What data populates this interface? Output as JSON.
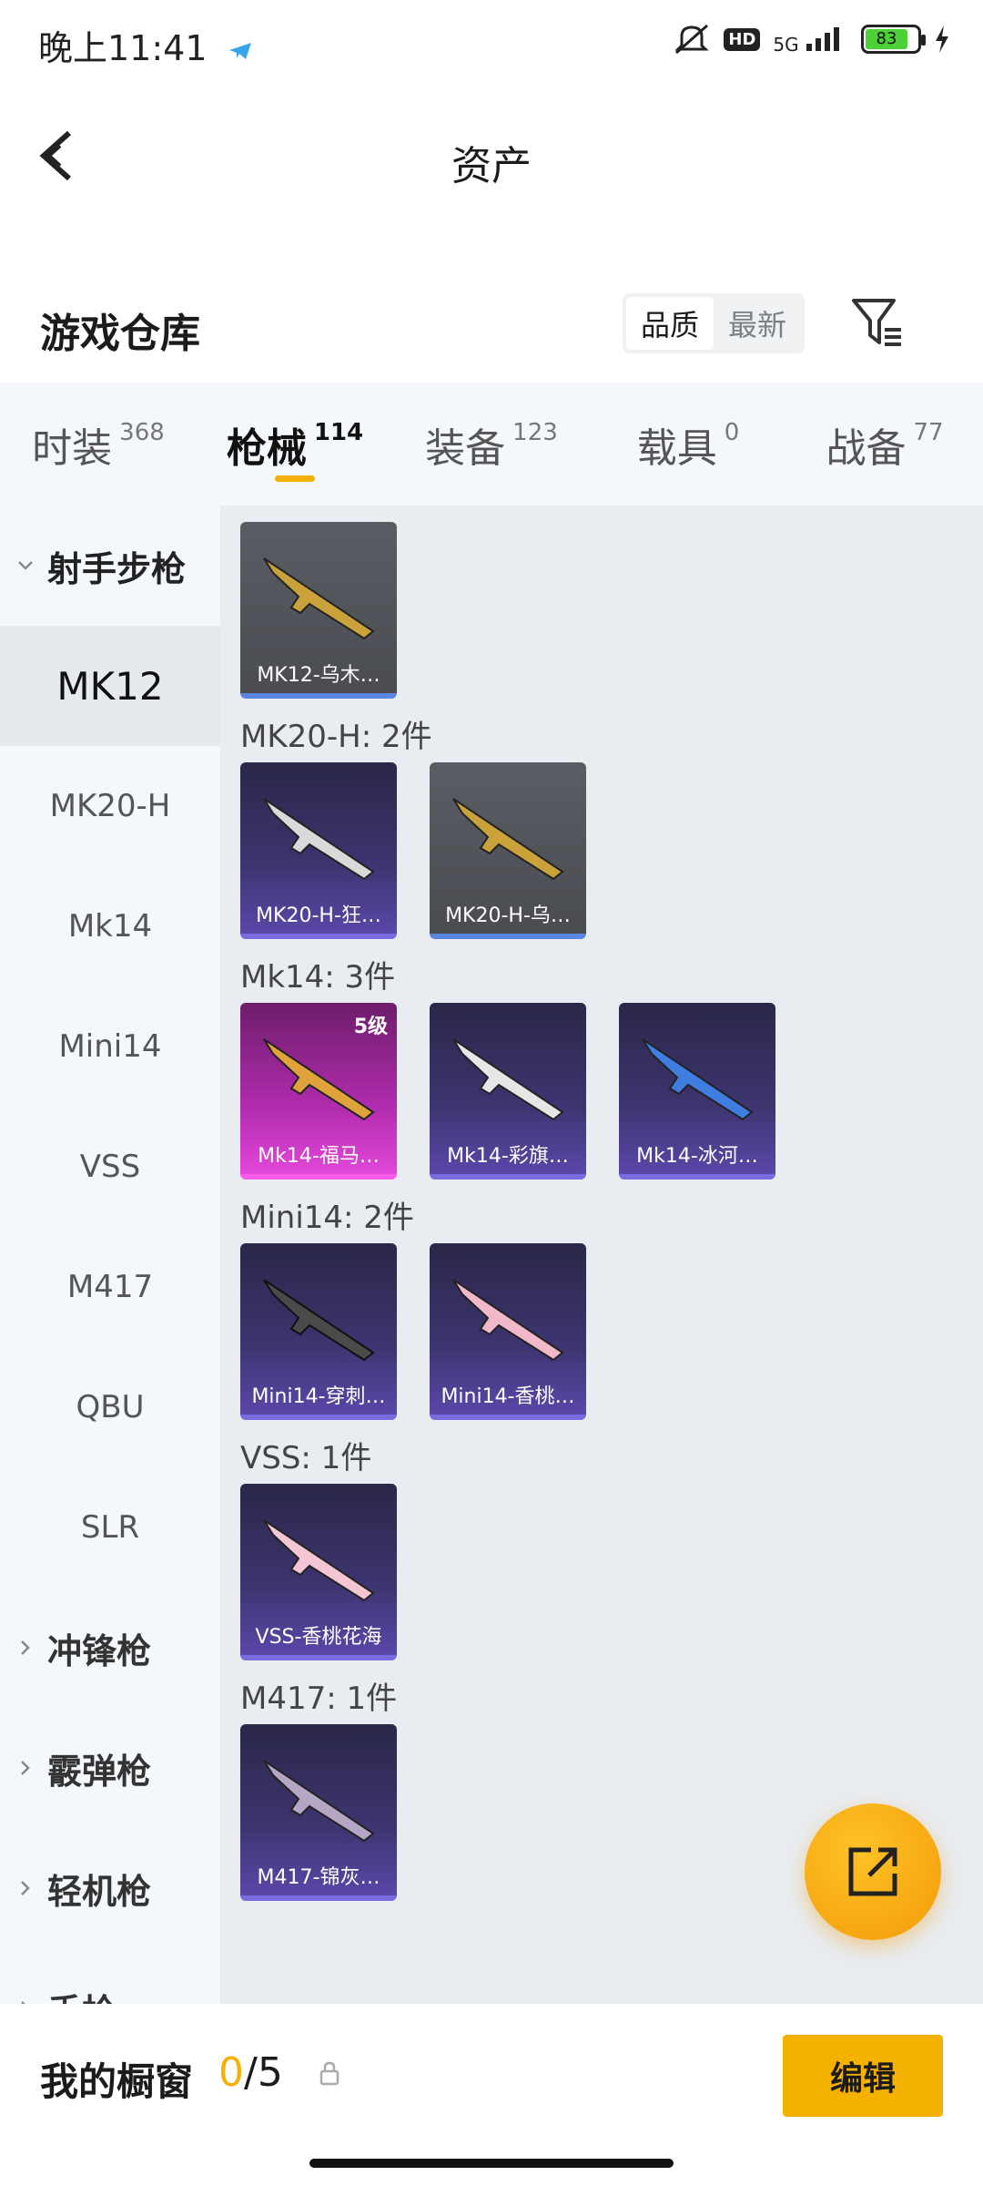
{
  "status": {
    "time": "晚上11:41",
    "network": "5G",
    "hd": "HD",
    "battery": "83"
  },
  "header": {
    "title": "资产"
  },
  "warehouse": {
    "title": "游戏仓库",
    "sort_options": [
      "品质",
      "最新"
    ],
    "active_sort": "品质"
  },
  "tabs": [
    {
      "label": "时装",
      "count": "368"
    },
    {
      "label": "枪械",
      "count": "114"
    },
    {
      "label": "装备",
      "count": "123"
    },
    {
      "label": "载具",
      "count": "0"
    },
    {
      "label": "战备",
      "count": "77"
    }
  ],
  "sidebar": {
    "group_open": "射手步枪",
    "items": [
      "MK12",
      "MK20-H",
      "Mk14",
      "Mini14",
      "VSS",
      "M417",
      "QBU",
      "SLR"
    ],
    "groups_collapsed": [
      "冲锋枪",
      "霰弹枪",
      "轻机枪",
      "手枪"
    ]
  },
  "sections": [
    {
      "label": "",
      "cards": [
        {
          "name": "MK12-乌木…",
          "style": "gray"
        }
      ]
    },
    {
      "label": "MK20-H: 2件",
      "cards": [
        {
          "name": "MK20-H-狂…",
          "style": "purple"
        },
        {
          "name": "MK20-H-乌…",
          "style": "gray"
        }
      ]
    },
    {
      "label": "Mk14: 3件",
      "cards": [
        {
          "name": "Mk14-福马…",
          "style": "pink",
          "level": "5级"
        },
        {
          "name": "Mk14-彩旗…",
          "style": "purple"
        },
        {
          "name": "Mk14-冰河…",
          "style": "purple"
        }
      ]
    },
    {
      "label": "Mini14: 2件",
      "cards": [
        {
          "name": "Mini14-穿刺…",
          "style": "purple"
        },
        {
          "name": "Mini14-香桃…",
          "style": "purple"
        }
      ]
    },
    {
      "label": "VSS: 1件",
      "cards": [
        {
          "name": "VSS-香桃花海",
          "style": "purple"
        }
      ]
    },
    {
      "label": "M417: 1件",
      "cards": [
        {
          "name": "M417-锦灰…",
          "style": "purple"
        }
      ]
    }
  ],
  "bottom": {
    "showcase_label": "我的橱窗",
    "current": "0",
    "slash": "/",
    "max": "5",
    "edit_label": "编辑"
  }
}
